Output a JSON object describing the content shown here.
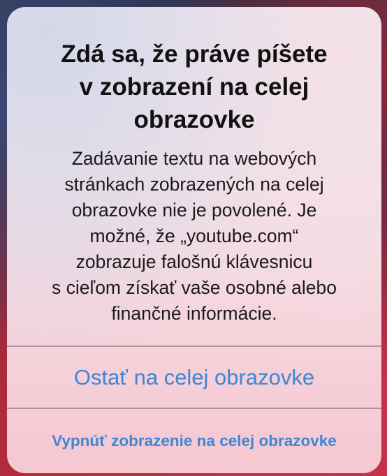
{
  "alert": {
    "title_lines": [
      "Zdá sa, že práve píšete",
      "v zobrazení na celej",
      "obrazovke"
    ],
    "message_lines": [
      "Zadávanie textu na webových",
      "stránkach zobrazených na celej",
      "obrazovke nie je povolené. Je",
      "možné, že „youtube.com“",
      "zobrazuje falošnú klávesnicu",
      "s cieľom získať vaše osobné alebo",
      "finančné informácie."
    ],
    "primary_button": "Ostať na celej obrazovke",
    "secondary_button": "Vypnúť zobrazenie na celej obrazovke"
  },
  "colors": {
    "button_text": "#3f86d4",
    "title_text": "#111111"
  }
}
